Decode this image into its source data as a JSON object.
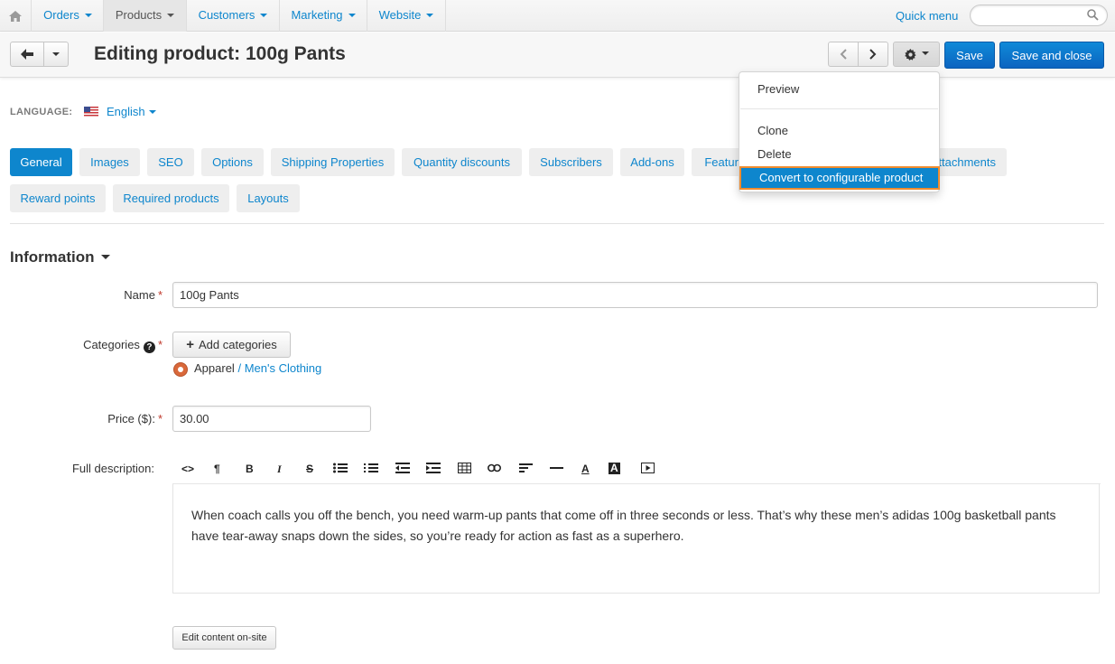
{
  "nav": {
    "items": [
      {
        "label": "Orders"
      },
      {
        "label": "Products"
      },
      {
        "label": "Customers"
      },
      {
        "label": "Marketing"
      },
      {
        "label": "Website"
      }
    ],
    "quick_menu": "Quick menu",
    "search_value": ""
  },
  "header": {
    "title": "Editing product: 100g Pants",
    "save": "Save",
    "save_close": "Save and close"
  },
  "menu": {
    "items": [
      {
        "label": "Preview"
      },
      {
        "label": "Clone"
      },
      {
        "label": "Delete"
      },
      {
        "label": "Convert to configurable product"
      }
    ]
  },
  "language": {
    "label": "LANGUAGE:",
    "value": "English"
  },
  "tabs": [
    {
      "label": "General"
    },
    {
      "label": "Images"
    },
    {
      "label": "SEO"
    },
    {
      "label": "Options"
    },
    {
      "label": "Shipping Properties"
    },
    {
      "label": "Quantity discounts"
    },
    {
      "label": "Subscribers"
    },
    {
      "label": "Add-ons"
    },
    {
      "label": "Features"
    },
    {
      "label": "Attachments"
    },
    {
      "label": "Reward points"
    },
    {
      "label": "Required products"
    },
    {
      "label": "Layouts"
    }
  ],
  "form": {
    "section": "Information",
    "name_label": "Name",
    "name_value": "100g Pants",
    "categories_label": "Categories",
    "add_categories": "Add categories",
    "category_parent": "Apparel",
    "category_sep": "/",
    "category_child": "Men's Clothing",
    "price_label": "Price ($):",
    "price_value": "30.00",
    "desc_label": "Full description:",
    "desc_text": "When coach calls you off the bench, you need warm-up pants that come off in three seconds or less. That’s why these men’s adidas 100g basketball pants have tear-away snaps down the sides, so you’re ready for action as fast as a superhero.",
    "edit_onsite": "Edit content on-site",
    "required_mark": "*"
  },
  "colors": {
    "primary": "#0e86cd",
    "highlight_border": "#f08c2e"
  }
}
